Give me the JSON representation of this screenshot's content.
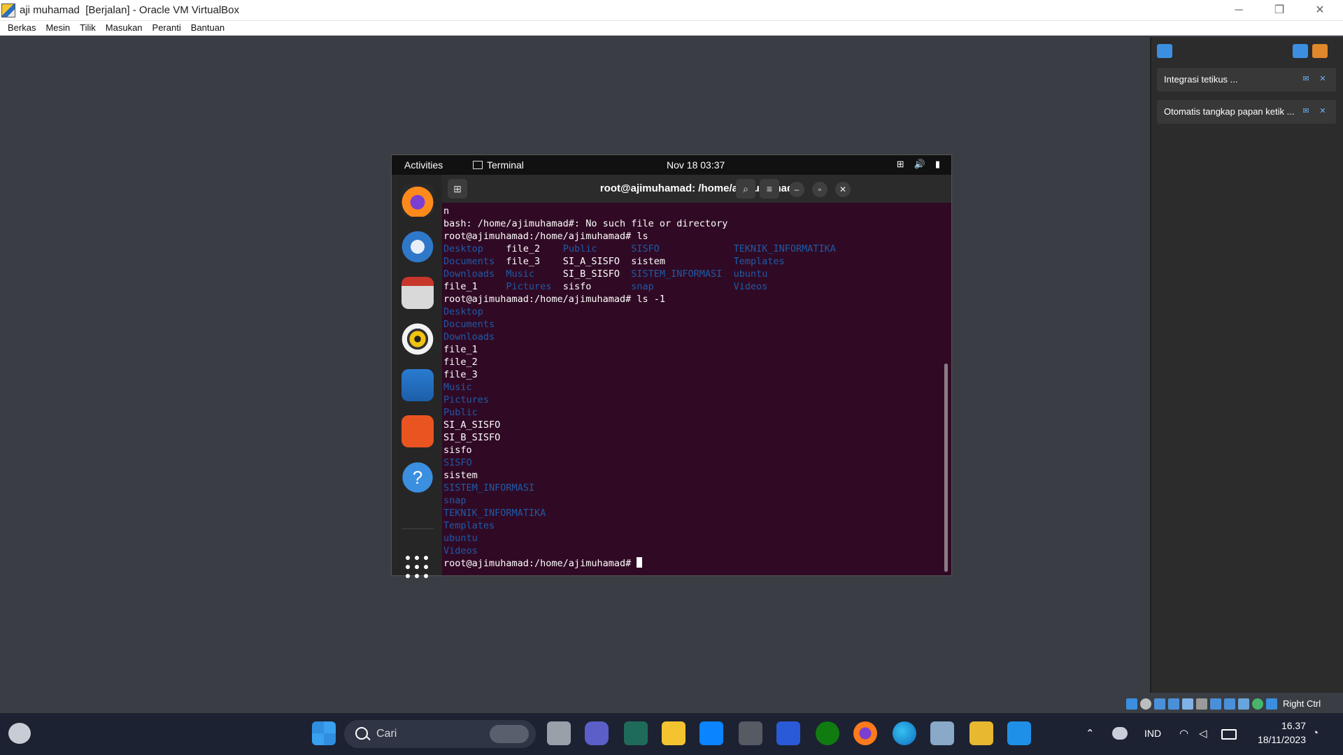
{
  "window": {
    "title": "aji muhamad  [Berjalan] - Oracle VM VirtualBox",
    "minimize": "─",
    "restore": "❐",
    "close": "✕"
  },
  "menu": [
    "Berkas",
    "Mesin",
    "Tilik",
    "Masukan",
    "Peranti",
    "Bantuan"
  ],
  "notifications": [
    {
      "text": "Integrasi tetikus ..."
    },
    {
      "text": "Otomatis tangkap papan ketik ..."
    }
  ],
  "vm": {
    "activities": "Activities",
    "app": "Terminal",
    "clock": "Nov 18  03:37",
    "tray": {
      "network": "⊞",
      "volume": "🔊",
      "battery": "▮"
    },
    "dock": [
      "firefox-icon",
      "thunderbird-icon",
      "files-icon",
      "rhythmbox-icon",
      "libreoffice-writer-icon",
      "app-center-icon",
      "help-icon"
    ],
    "terminal": {
      "title": "root@ajimuhamad: /home/ajimuhamad",
      "lines": [
        "n",
        "bash: /home/ajimuhamad#: No such file or directory",
        "root@ajimuhamad:/home/ajimuhamad# ls"
      ],
      "ls_rows": [
        [
          [
            "Desktop",
            "d"
          ],
          [
            "file_2",
            "f"
          ],
          [
            "Public",
            "d"
          ],
          [
            "SISFO",
            "d"
          ],
          [
            "TEKNIK_INFORMATIKA",
            "d"
          ]
        ],
        [
          [
            "Documents",
            "d"
          ],
          [
            "file_3",
            "f"
          ],
          [
            "SI_A_SISFO",
            "f"
          ],
          [
            "sistem",
            "f"
          ],
          [
            "Templates",
            "d"
          ]
        ],
        [
          [
            "Downloads",
            "d"
          ],
          [
            "Music",
            "d"
          ],
          [
            "SI_B_SISFO",
            "f"
          ],
          [
            "SISTEM_INFORMASI",
            "d"
          ],
          [
            "ubuntu",
            "d"
          ]
        ],
        [
          [
            "file_1",
            "f"
          ],
          [
            "Pictures",
            "d"
          ],
          [
            "sisfo",
            "f"
          ],
          [
            "snap",
            "d"
          ],
          [
            "Videos",
            "d"
          ]
        ]
      ],
      "cmd2": "root@ajimuhamad:/home/ajimuhamad# ls -1",
      "list": [
        [
          "Desktop",
          "d"
        ],
        [
          "Documents",
          "d"
        ],
        [
          "Downloads",
          "d"
        ],
        [
          "file_1",
          "f"
        ],
        [
          "file_2",
          "f"
        ],
        [
          "file_3",
          "f"
        ],
        [
          "Music",
          "d"
        ],
        [
          "Pictures",
          "d"
        ],
        [
          "Public",
          "d"
        ],
        [
          "SI_A_SISFO",
          "f"
        ],
        [
          "SI_B_SISFO",
          "f"
        ],
        [
          "sisfo",
          "f"
        ],
        [
          "SISFO",
          "d"
        ],
        [
          "sistem",
          "f"
        ],
        [
          "SISTEM_INFORMASI",
          "d"
        ],
        [
          "snap",
          "d"
        ],
        [
          "TEKNIK_INFORMATIKA",
          "d"
        ],
        [
          "Templates",
          "d"
        ],
        [
          "ubuntu",
          "d"
        ],
        [
          "Videos",
          "d"
        ]
      ],
      "prompt": "root@ajimuhamad:/home/ajimuhamad# "
    }
  },
  "vbox_status": {
    "host_key": "Right Ctrl"
  },
  "taskbar": {
    "search_label": "Cari",
    "lang": "IND",
    "time": "16.37",
    "date": "18/11/2023"
  },
  "colors": {
    "terminal_bg": "#300a24",
    "dir_blue": "#1e5aa8",
    "taskbar": "#1c2232"
  }
}
